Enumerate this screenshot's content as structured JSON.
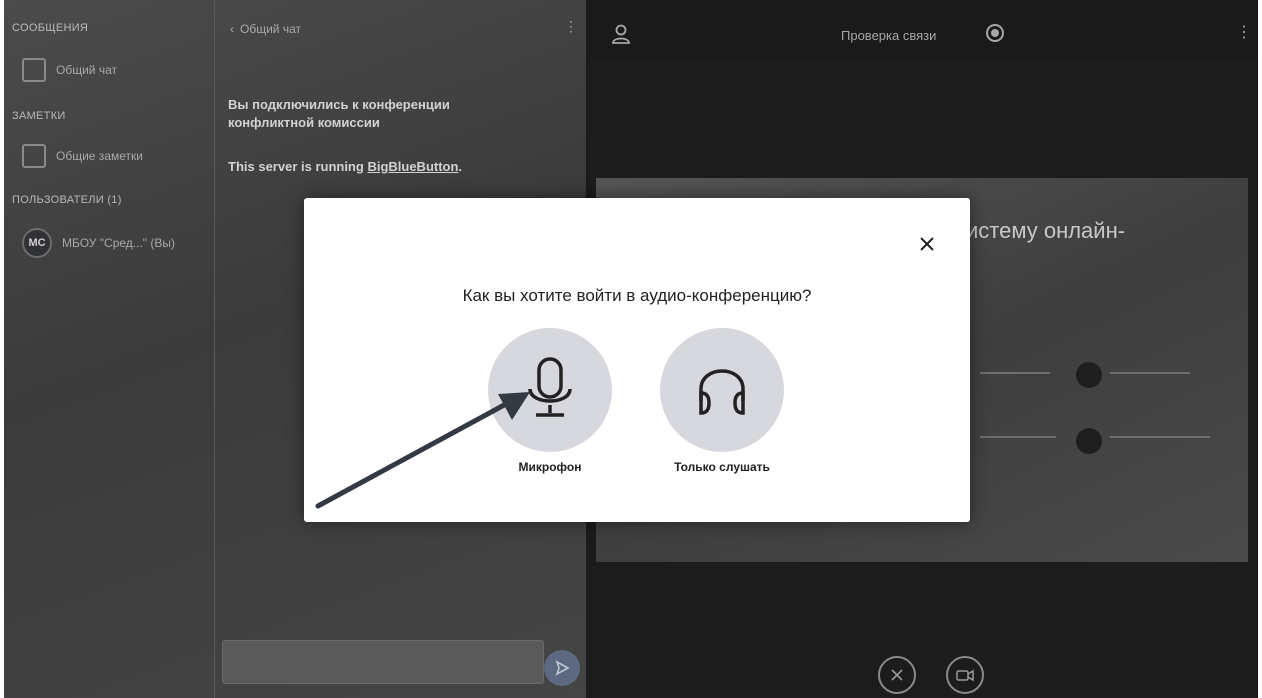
{
  "sidebar": {
    "messages_header": "СООБЩЕНИЯ",
    "public_chat": "Общий чат",
    "notes_header": "ЗАМЕТКИ",
    "shared_notes": "Общие заметки",
    "users_header": "ПОЛЬЗОВАТЕЛИ (1)",
    "user_avatar": "МС",
    "user_name": "МБОУ \"Сред...\" (Вы)"
  },
  "chat": {
    "back_label": "Общий чат",
    "welcome_message": "Вы подключились к конференции конфликтной комиссии",
    "server_text": "This server is running ",
    "server_link": "BigBlueButton",
    "server_dot": "."
  },
  "topbar": {
    "title": "Проверка связи"
  },
  "presentation": {
    "slide_title_fragment": "истему онлайн-"
  },
  "audio_modal": {
    "title": "Как вы хотите войти в аудио-конференцию?",
    "option_microphone": "Микрофон",
    "option_listen_only": "Только слушать",
    "icons": {
      "close": "close-icon",
      "microphone": "microphone-icon",
      "headphones": "headphones-icon"
    }
  },
  "colors": {
    "modal_bg": "#ffffff",
    "option_circle": "#d6d8de",
    "overlay_dark": "#2a2a2a",
    "arrow": "#333a44"
  }
}
